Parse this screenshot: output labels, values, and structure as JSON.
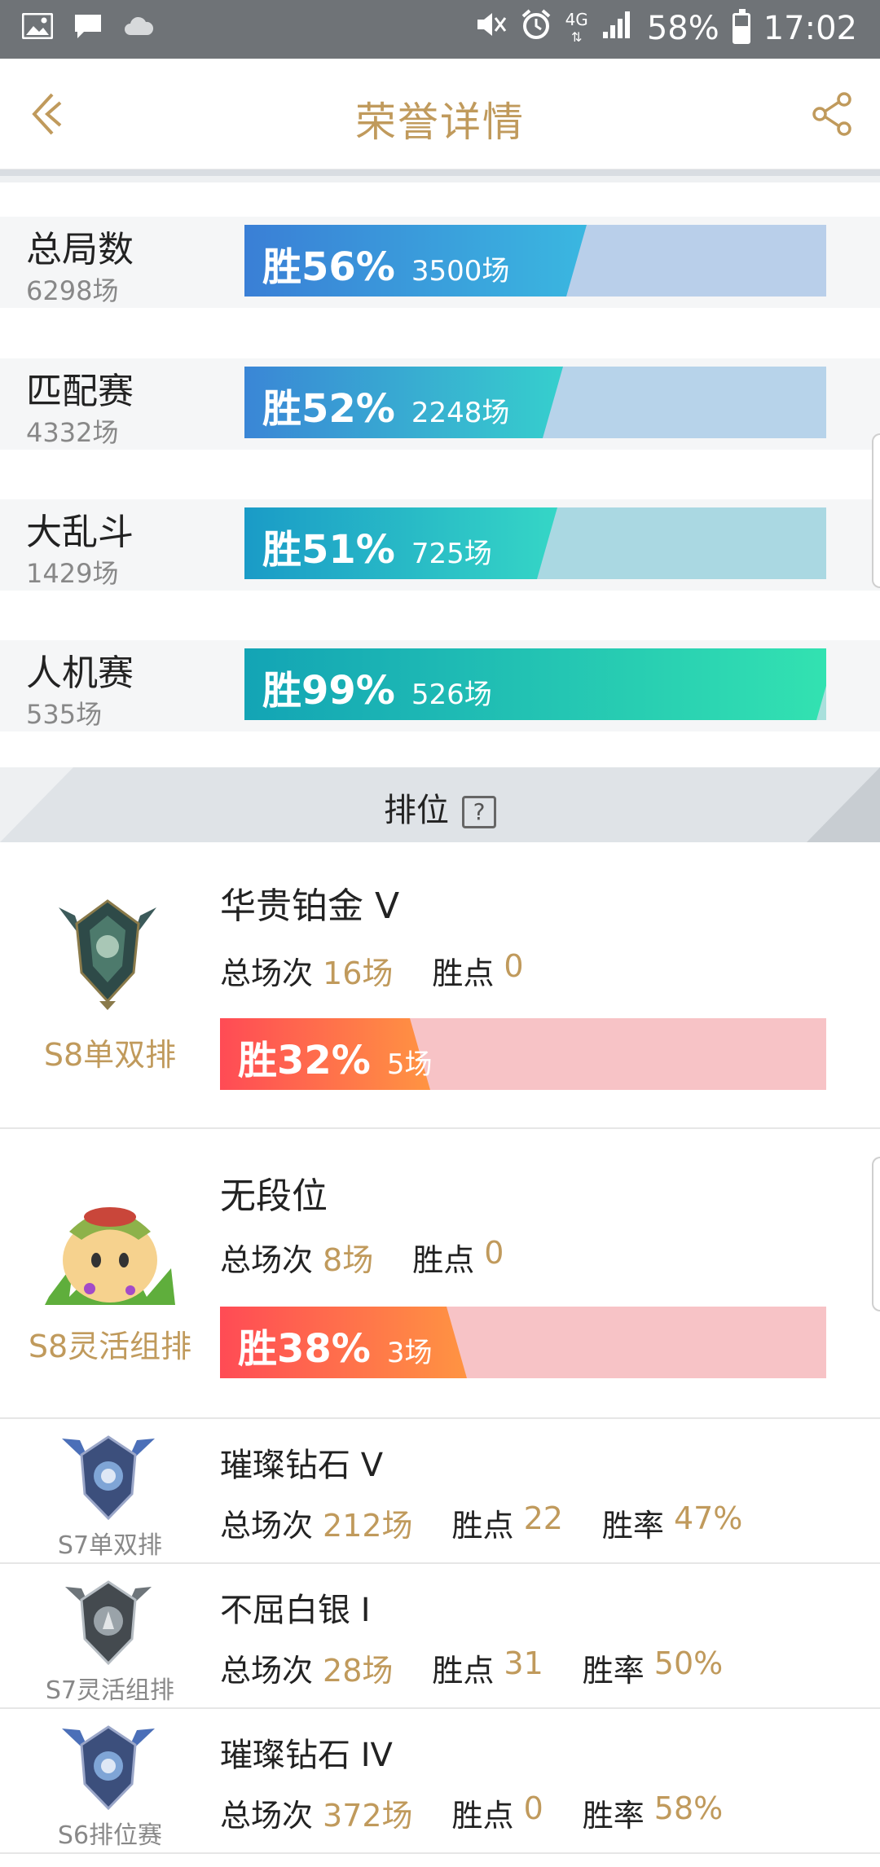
{
  "statusbar": {
    "battery": "58%",
    "time": "17:02",
    "network": "4G",
    "left_icons": [
      "gallery-icon",
      "message-icon",
      "cloud-icon"
    ],
    "right_icons": [
      "mute-icon",
      "alarm-icon",
      "4g-icon",
      "signal-icon",
      "battery-icon"
    ]
  },
  "header": {
    "title": "荣誉详情",
    "back_icon": "back-chevron-icon",
    "share_icon": "share-icon"
  },
  "colors": {
    "gold": "#c09a5c",
    "blue": "#3a7fd6",
    "teal": "#23c7b8",
    "red": "#ff4b55",
    "pink_bg": "#f7c3c6"
  },
  "stats": [
    {
      "label": "总局数",
      "sub": "6298场",
      "pct_text": "胜56%",
      "count": "3500场",
      "win_rate": 0.56
    },
    {
      "label": "匹配赛",
      "sub": "4332场",
      "pct_text": "胜52%",
      "count": "2248场",
      "win_rate": 0.52
    },
    {
      "label": "大乱斗",
      "sub": "1429场",
      "pct_text": "胜51%",
      "count": "725场",
      "win_rate": 0.51
    },
    {
      "label": "人机赛",
      "sub": "535场",
      "pct_text": "胜99%",
      "count": "526场",
      "win_rate": 0.99
    }
  ],
  "ranking": {
    "title": "排位",
    "help_mark": "?",
    "cards": [
      {
        "season": "S8单双排",
        "tier": "华贵铂金 V",
        "games_label": "总场次",
        "games": "16场",
        "points_label": "胜点",
        "points": "0",
        "pct_text": "胜32%",
        "count": "5场",
        "win_rate": 0.32,
        "emblem": "platinum-emblem-icon"
      },
      {
        "season": "S8灵活组排",
        "tier": "无段位",
        "games_label": "总场次",
        "games": "8场",
        "points_label": "胜点",
        "points": "0",
        "pct_text": "胜38%",
        "count": "3场",
        "win_rate": 0.38,
        "emblem": "unranked-teemo-icon"
      },
      {
        "season": "S7单双排",
        "tier": "璀璨钻石 V",
        "games_label": "总场次",
        "games": "212场",
        "points_label": "胜点",
        "points": "22",
        "rate_label": "胜率",
        "rate": "47%",
        "emblem": "diamond-emblem-icon"
      },
      {
        "season": "S7灵活组排",
        "tier": "不屈白银 I",
        "games_label": "总场次",
        "games": "28场",
        "points_label": "胜点",
        "points": "31",
        "rate_label": "胜率",
        "rate": "50%",
        "emblem": "silver-emblem-icon"
      },
      {
        "season": "S6排位赛",
        "tier": "璀璨钻石 IV",
        "games_label": "总场次",
        "games": "372场",
        "points_label": "胜点",
        "points": "0",
        "rate_label": "胜率",
        "rate": "58%",
        "emblem": "diamond-emblem-icon"
      }
    ]
  }
}
